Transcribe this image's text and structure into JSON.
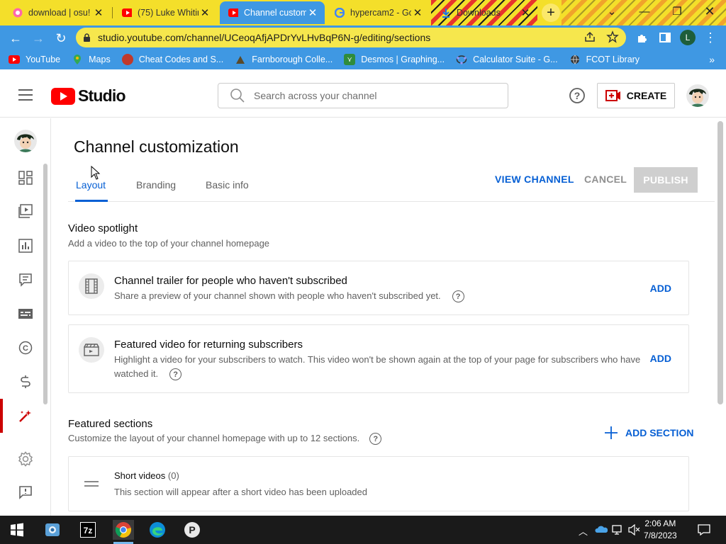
{
  "browser": {
    "tabs": [
      {
        "title": "download | osu!",
        "favicon": "osu-icon"
      },
      {
        "title": "(75) Luke Whitin",
        "favicon": "youtube-icon"
      },
      {
        "title": "Channel custom",
        "favicon": "youtube-studio-icon",
        "active": true
      },
      {
        "title": "hypercam2 - Go",
        "favicon": "google-icon"
      },
      {
        "title": "Downloads",
        "favicon": "download-icon"
      }
    ],
    "url": "studio.youtube.com/channel/UCeoqAfjAPDrYvLHvBqP6N-g/editing/sections",
    "profile_initial": "L",
    "bookmarks": [
      {
        "label": "YouTube",
        "icon": "youtube-icon"
      },
      {
        "label": "Maps",
        "icon": "maps-icon"
      },
      {
        "label": "Cheat Codes and S...",
        "icon": "cheat-codes-icon"
      },
      {
        "label": "Farnborough Colle...",
        "icon": "college-icon"
      },
      {
        "label": "Desmos | Graphing...",
        "icon": "desmos-icon"
      },
      {
        "label": "Calculator Suite - G...",
        "icon": "geogebra-icon"
      },
      {
        "label": "FCOT Library",
        "icon": "globe-icon"
      }
    ],
    "bookmarks_more": "»"
  },
  "studio": {
    "logo_text": "Studio",
    "search_placeholder": "Search across your channel",
    "create_label": "CREATE",
    "page_title": "Channel customization",
    "tabs": [
      "Layout",
      "Branding",
      "Basic info"
    ],
    "active_tab": "Layout",
    "view_channel": "VIEW CHANNEL",
    "cancel": "CANCEL",
    "publish": "PUBLISH",
    "video_spotlight": {
      "title": "Video spotlight",
      "subtitle": "Add a video to the top of your channel homepage",
      "trailer": {
        "title": "Channel trailer for people who haven't subscribed",
        "desc": "Share a preview of your channel shown with people who haven't subscribed yet.",
        "action": "ADD"
      },
      "featured": {
        "title": "Featured video for returning subscribers",
        "desc_line1": "Highlight a video for your subscribers to watch. This video won't be shown again at the top of your page for subscribers who have",
        "desc_line2": "watched it.",
        "action": "ADD"
      }
    },
    "featured_sections": {
      "title": "Featured sections",
      "subtitle": "Customize the layout of your channel homepage with up to 12 sections.",
      "add_section": "ADD SECTION",
      "items": [
        {
          "title": "Short videos",
          "count": "(0)",
          "desc": "This section will appear after a short video has been uploaded"
        }
      ]
    },
    "sidebar_icons": [
      "dashboard-icon",
      "content-icon",
      "analytics-icon",
      "comments-icon",
      "subtitles-icon",
      "copyright-icon",
      "earn-icon",
      "customization-icon",
      "settings-icon",
      "feedback-icon"
    ]
  },
  "taskbar": {
    "time": "2:06 AM",
    "date": "7/8/2023"
  }
}
